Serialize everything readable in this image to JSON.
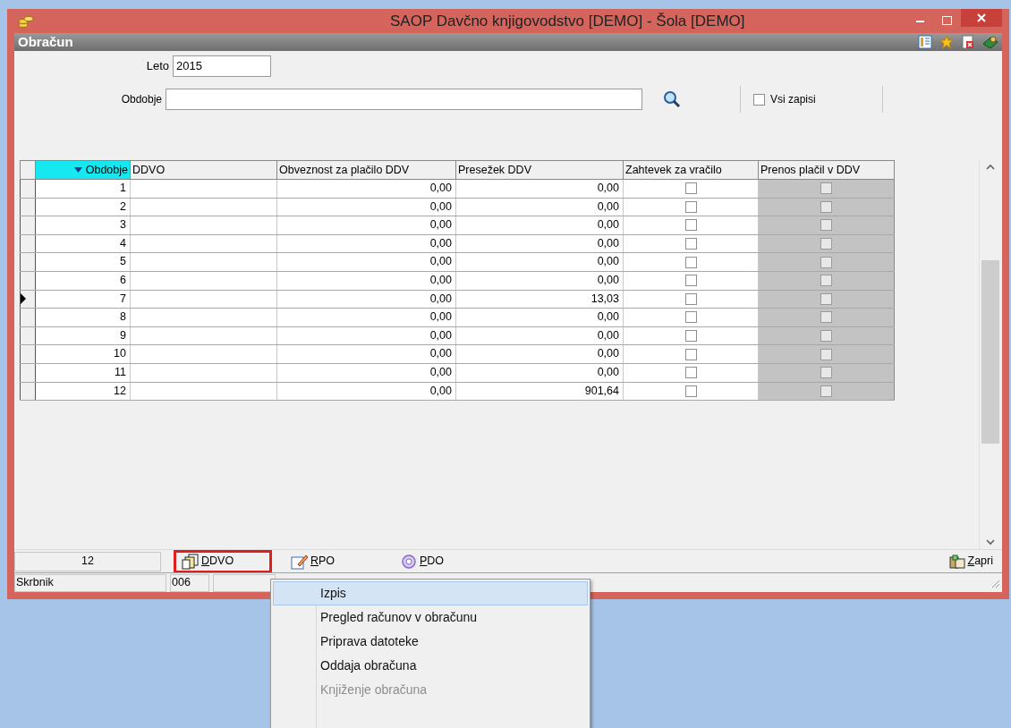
{
  "window": {
    "title": "SAOP Davčno knjigovodstvo [DEMO] - Šola [DEMO]"
  },
  "panel": {
    "title": "Obračun"
  },
  "form": {
    "year_label": "Leto",
    "year_value": "2015",
    "period_label": "Obdobje",
    "all_records": {
      "label": "Vsi zapisi",
      "checked": false
    }
  },
  "table": {
    "columns": [
      {
        "label": "Obdobje",
        "sorted": true
      },
      {
        "label": "DDVO",
        "sorted": false
      },
      {
        "label": "Obveznost za plačilo DDV",
        "sorted": false
      },
      {
        "label": "Presežek DDV",
        "sorted": false
      },
      {
        "label": "Zahtevek za vračilo",
        "sorted": false
      },
      {
        "label": "Prenos plačil v DDV",
        "sorted": false
      }
    ],
    "rows": [
      {
        "period": "1",
        "payable": "0,00",
        "excess": "0,00",
        "refund": false,
        "transfer": false,
        "selected": false
      },
      {
        "period": "2",
        "payable": "0,00",
        "excess": "0,00",
        "refund": false,
        "transfer": false,
        "selected": false
      },
      {
        "period": "3",
        "payable": "0,00",
        "excess": "0,00",
        "refund": false,
        "transfer": false,
        "selected": false
      },
      {
        "period": "4",
        "payable": "0,00",
        "excess": "0,00",
        "refund": false,
        "transfer": false,
        "selected": false
      },
      {
        "period": "5",
        "payable": "0,00",
        "excess": "0,00",
        "refund": false,
        "transfer": false,
        "selected": false
      },
      {
        "period": "6",
        "payable": "0,00",
        "excess": "0,00",
        "refund": false,
        "transfer": false,
        "selected": false
      },
      {
        "period": "7",
        "payable": "0,00",
        "excess": "13,03",
        "refund": false,
        "transfer": false,
        "selected": true
      },
      {
        "period": "8",
        "payable": "0,00",
        "excess": "0,00",
        "refund": false,
        "transfer": false,
        "selected": false
      },
      {
        "period": "9",
        "payable": "0,00",
        "excess": "0,00",
        "refund": false,
        "transfer": false,
        "selected": false
      },
      {
        "period": "10",
        "payable": "0,00",
        "excess": "0,00",
        "refund": false,
        "transfer": false,
        "selected": false
      },
      {
        "period": "11",
        "payable": "0,00",
        "excess": "0,00",
        "refund": false,
        "transfer": false,
        "selected": false
      },
      {
        "period": "12",
        "payable": "0,00",
        "excess": "901,64",
        "refund": false,
        "transfer": false,
        "selected": false
      }
    ]
  },
  "footer": {
    "count": "12",
    "buttons": [
      {
        "kind": "ddvo",
        "label": "DDVO",
        "highlighted": true
      },
      {
        "kind": "rpo",
        "label": "RPO",
        "highlighted": false
      },
      {
        "kind": "pdo",
        "label": "PDO",
        "highlighted": false
      }
    ],
    "close": "Zapri"
  },
  "status_bar": {
    "field_1": "Skrbnik",
    "field_2": "006"
  },
  "context_menu": {
    "items": [
      {
        "label": "Izpis",
        "selected": true,
        "disabled": false
      },
      {
        "label": "Pregled računov v obračunu",
        "selected": false,
        "disabled": false
      },
      {
        "label": "Priprava datoteke",
        "selected": false,
        "disabled": false
      },
      {
        "label": "Oddaja obračuna",
        "selected": false,
        "disabled": false
      },
      {
        "label": "Knjiženje obračuna",
        "selected": false,
        "disabled": true
      }
    ]
  }
}
